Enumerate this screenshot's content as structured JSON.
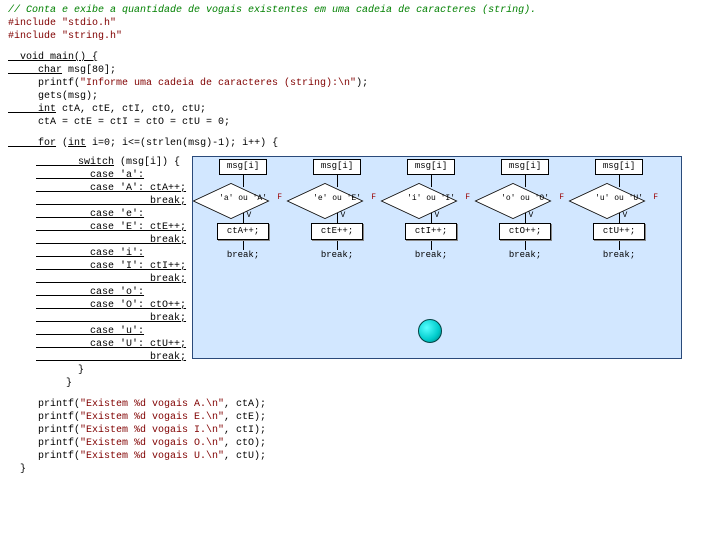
{
  "code": {
    "comment": "// Conta e exibe a quantidade de vogais existentes em uma cadeia de caracteres (string).",
    "inc1a": "#include ",
    "inc1b": "\"stdio.h\"",
    "inc2a": "#include ",
    "inc2b": "\"string.h\"",
    "main1": "  void main() {",
    "main2a": "     char",
    "main2b": " msg[80];",
    "main3a": "     printf(",
    "main3b": "\"Informe uma cadeia de caracteres (string):\\n\"",
    "main3c": ");",
    "main4": "     gets(msg);",
    "main5a": "     int",
    "main5b": " ctA, ctE, ctI, ctO, ctU;",
    "main6": "     ctA = ctE = ctI = ctO = ctU = 0;",
    "for1a": "     for",
    "for1b": " (",
    "for1c": "int",
    "for1d": " i=0; i<=(strlen(msg)-1); i++) {",
    "sw1a": "       switch",
    "sw1b": " (msg[i]) {",
    "c_a1": "         case 'a':",
    "c_a2": "         case 'A': ctA++;",
    "brk": "                   break;",
    "c_e1": "         case 'e':",
    "c_e2": "         case 'E': ctE++;",
    "c_i1": "         case 'i':",
    "c_i2": "         case 'I': ctI++;",
    "c_o1": "         case 'o':",
    "c_o2": "         case 'O': ctO++;",
    "c_u1": "         case 'u':",
    "c_u2": "         case 'U': ctU++;",
    "close1": "       }",
    "close2": "     }",
    "p1a": "     printf(",
    "p1b": "\"Existem %d vogais A.\\n\"",
    "p1c": ", ctA);",
    "p2a": "     printf(",
    "p2b": "\"Existem %d vogais E.\\n\"",
    "p2c": ", ctE);",
    "p3a": "     printf(",
    "p3b": "\"Existem %d vogais I.\\n\"",
    "p3c": ", ctI);",
    "p4a": "     printf(",
    "p4b": "\"Existem %d vogais O.\\n\"",
    "p4c": ", ctO);",
    "p5a": "     printf(",
    "p5b": "\"Existem %d vogais U.\\n\"",
    "p5c": ", ctU);",
    "close3": "  }"
  },
  "flow": {
    "msg": "msg[i]",
    "V": "V",
    "F": "F",
    "break": "break;",
    "cols": [
      {
        "cond": "'a' ou 'A'",
        "act": "ctA++;"
      },
      {
        "cond": "'e' ou 'E'",
        "act": "ctE++;"
      },
      {
        "cond": "'i' ou 'I'",
        "act": "ctI++;"
      },
      {
        "cond": "'o' ou 'O'",
        "act": "ctO++;"
      },
      {
        "cond": "'u' ou 'U'",
        "act": "ctU++;"
      }
    ]
  }
}
